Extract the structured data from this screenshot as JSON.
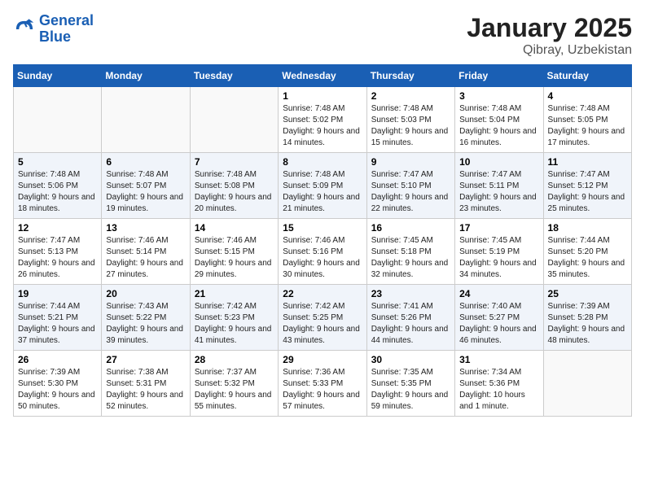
{
  "logo": {
    "line1": "General",
    "line2": "Blue"
  },
  "title": "January 2025",
  "subtitle": "Qibray, Uzbekistan",
  "days_header": [
    "Sunday",
    "Monday",
    "Tuesday",
    "Wednesday",
    "Thursday",
    "Friday",
    "Saturday"
  ],
  "weeks": [
    [
      {
        "day": "",
        "info": ""
      },
      {
        "day": "",
        "info": ""
      },
      {
        "day": "",
        "info": ""
      },
      {
        "day": "1",
        "info": "Sunrise: 7:48 AM\nSunset: 5:02 PM\nDaylight: 9 hours\nand 14 minutes."
      },
      {
        "day": "2",
        "info": "Sunrise: 7:48 AM\nSunset: 5:03 PM\nDaylight: 9 hours\nand 15 minutes."
      },
      {
        "day": "3",
        "info": "Sunrise: 7:48 AM\nSunset: 5:04 PM\nDaylight: 9 hours\nand 16 minutes."
      },
      {
        "day": "4",
        "info": "Sunrise: 7:48 AM\nSunset: 5:05 PM\nDaylight: 9 hours\nand 17 minutes."
      }
    ],
    [
      {
        "day": "5",
        "info": "Sunrise: 7:48 AM\nSunset: 5:06 PM\nDaylight: 9 hours\nand 18 minutes."
      },
      {
        "day": "6",
        "info": "Sunrise: 7:48 AM\nSunset: 5:07 PM\nDaylight: 9 hours\nand 19 minutes."
      },
      {
        "day": "7",
        "info": "Sunrise: 7:48 AM\nSunset: 5:08 PM\nDaylight: 9 hours\nand 20 minutes."
      },
      {
        "day": "8",
        "info": "Sunrise: 7:48 AM\nSunset: 5:09 PM\nDaylight: 9 hours\nand 21 minutes."
      },
      {
        "day": "9",
        "info": "Sunrise: 7:47 AM\nSunset: 5:10 PM\nDaylight: 9 hours\nand 22 minutes."
      },
      {
        "day": "10",
        "info": "Sunrise: 7:47 AM\nSunset: 5:11 PM\nDaylight: 9 hours\nand 23 minutes."
      },
      {
        "day": "11",
        "info": "Sunrise: 7:47 AM\nSunset: 5:12 PM\nDaylight: 9 hours\nand 25 minutes."
      }
    ],
    [
      {
        "day": "12",
        "info": "Sunrise: 7:47 AM\nSunset: 5:13 PM\nDaylight: 9 hours\nand 26 minutes."
      },
      {
        "day": "13",
        "info": "Sunrise: 7:46 AM\nSunset: 5:14 PM\nDaylight: 9 hours\nand 27 minutes."
      },
      {
        "day": "14",
        "info": "Sunrise: 7:46 AM\nSunset: 5:15 PM\nDaylight: 9 hours\nand 29 minutes."
      },
      {
        "day": "15",
        "info": "Sunrise: 7:46 AM\nSunset: 5:16 PM\nDaylight: 9 hours\nand 30 minutes."
      },
      {
        "day": "16",
        "info": "Sunrise: 7:45 AM\nSunset: 5:18 PM\nDaylight: 9 hours\nand 32 minutes."
      },
      {
        "day": "17",
        "info": "Sunrise: 7:45 AM\nSunset: 5:19 PM\nDaylight: 9 hours\nand 34 minutes."
      },
      {
        "day": "18",
        "info": "Sunrise: 7:44 AM\nSunset: 5:20 PM\nDaylight: 9 hours\nand 35 minutes."
      }
    ],
    [
      {
        "day": "19",
        "info": "Sunrise: 7:44 AM\nSunset: 5:21 PM\nDaylight: 9 hours\nand 37 minutes."
      },
      {
        "day": "20",
        "info": "Sunrise: 7:43 AM\nSunset: 5:22 PM\nDaylight: 9 hours\nand 39 minutes."
      },
      {
        "day": "21",
        "info": "Sunrise: 7:42 AM\nSunset: 5:23 PM\nDaylight: 9 hours\nand 41 minutes."
      },
      {
        "day": "22",
        "info": "Sunrise: 7:42 AM\nSunset: 5:25 PM\nDaylight: 9 hours\nand 43 minutes."
      },
      {
        "day": "23",
        "info": "Sunrise: 7:41 AM\nSunset: 5:26 PM\nDaylight: 9 hours\nand 44 minutes."
      },
      {
        "day": "24",
        "info": "Sunrise: 7:40 AM\nSunset: 5:27 PM\nDaylight: 9 hours\nand 46 minutes."
      },
      {
        "day": "25",
        "info": "Sunrise: 7:39 AM\nSunset: 5:28 PM\nDaylight: 9 hours\nand 48 minutes."
      }
    ],
    [
      {
        "day": "26",
        "info": "Sunrise: 7:39 AM\nSunset: 5:30 PM\nDaylight: 9 hours\nand 50 minutes."
      },
      {
        "day": "27",
        "info": "Sunrise: 7:38 AM\nSunset: 5:31 PM\nDaylight: 9 hours\nand 52 minutes."
      },
      {
        "day": "28",
        "info": "Sunrise: 7:37 AM\nSunset: 5:32 PM\nDaylight: 9 hours\nand 55 minutes."
      },
      {
        "day": "29",
        "info": "Sunrise: 7:36 AM\nSunset: 5:33 PM\nDaylight: 9 hours\nand 57 minutes."
      },
      {
        "day": "30",
        "info": "Sunrise: 7:35 AM\nSunset: 5:35 PM\nDaylight: 9 hours\nand 59 minutes."
      },
      {
        "day": "31",
        "info": "Sunrise: 7:34 AM\nSunset: 5:36 PM\nDaylight: 10 hours\nand 1 minute."
      },
      {
        "day": "",
        "info": ""
      }
    ]
  ]
}
